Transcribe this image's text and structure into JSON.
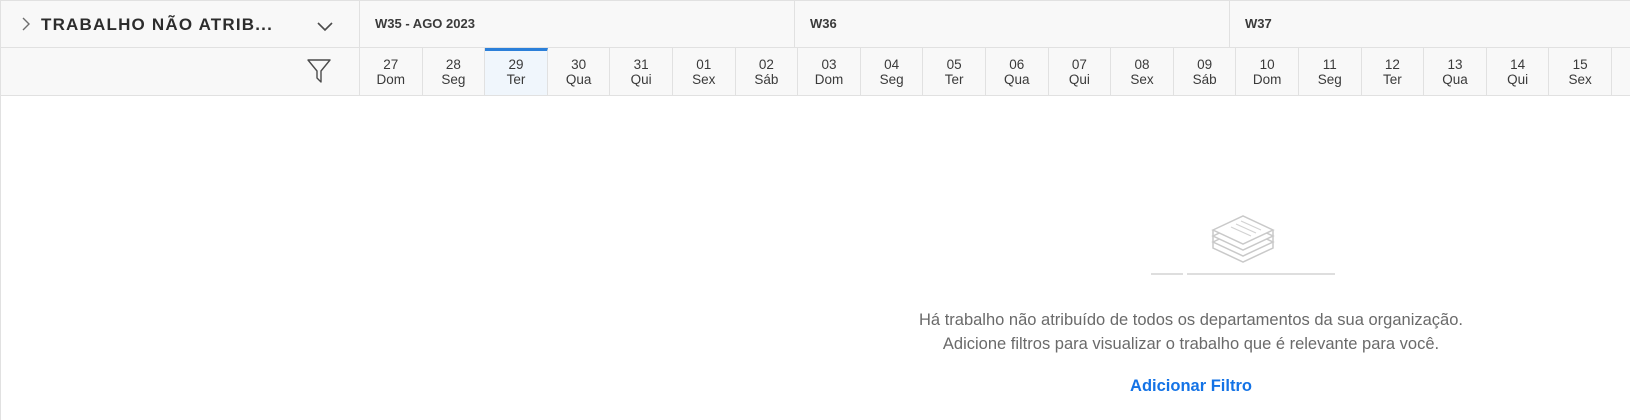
{
  "header": {
    "section_title": "TRABALHO NÃO ATRIB...",
    "weeks": [
      {
        "label": "W35 - AGO 2023"
      },
      {
        "label": "W36"
      },
      {
        "label": "W37"
      }
    ]
  },
  "days": [
    {
      "num": "27",
      "dow": "Dom"
    },
    {
      "num": "28",
      "dow": "Seg"
    },
    {
      "num": "29",
      "dow": "Ter",
      "today": true
    },
    {
      "num": "30",
      "dow": "Qua"
    },
    {
      "num": "31",
      "dow": "Qui"
    },
    {
      "num": "01",
      "dow": "Sex"
    },
    {
      "num": "02",
      "dow": "Sáb"
    },
    {
      "num": "03",
      "dow": "Dom"
    },
    {
      "num": "04",
      "dow": "Seg"
    },
    {
      "num": "05",
      "dow": "Ter"
    },
    {
      "num": "06",
      "dow": "Qua"
    },
    {
      "num": "07",
      "dow": "Qui"
    },
    {
      "num": "08",
      "dow": "Sex"
    },
    {
      "num": "09",
      "dow": "Sáb"
    },
    {
      "num": "10",
      "dow": "Dom"
    },
    {
      "num": "11",
      "dow": "Seg"
    },
    {
      "num": "12",
      "dow": "Ter"
    },
    {
      "num": "13",
      "dow": "Qua"
    },
    {
      "num": "14",
      "dow": "Qui"
    },
    {
      "num": "15",
      "dow": "Sex"
    }
  ],
  "empty_state": {
    "line1": "Há trabalho não atribuído de todos os departamentos da sua organização.",
    "line2": "Adicione filtros para visualizar o trabalho que é relevante para você.",
    "action_label": "Adicionar Filtro"
  },
  "icons": {
    "expand": "chevron-right-icon",
    "collapse": "chevron-down-icon",
    "filter": "funnel-icon",
    "empty": "stacked-papers-icon"
  },
  "colors": {
    "accent": "#1473e6",
    "today_bar": "#2b7fd9",
    "header_bg": "#f8f8f8"
  }
}
